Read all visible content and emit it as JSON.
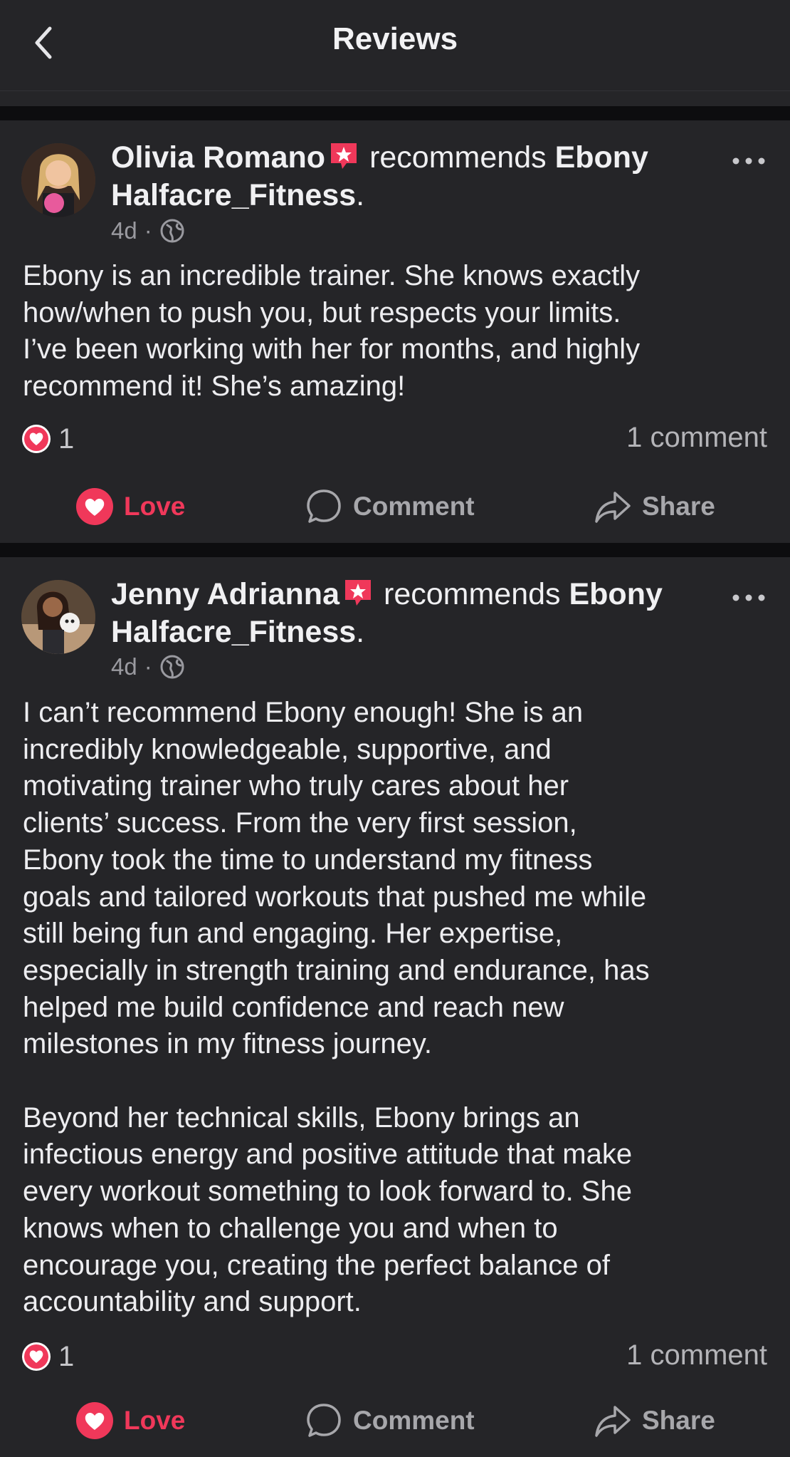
{
  "header": {
    "title": "Reviews"
  },
  "reviews": [
    {
      "author": "Olivia Romano",
      "verb": "recommends",
      "page_line1": "Ebony",
      "page_line2": "Halfacre_Fitness",
      "period": ".",
      "time": "4d",
      "separator": "·",
      "text": "Ebony is an incredible trainer. She knows exactly\nhow/when to push you, but respects your limits.\nI’ve been working with her for months, and highly\nrecommend it! She’s amazing!",
      "reaction_count": "1",
      "comment_count": "1 comment"
    },
    {
      "author": "Jenny Adrianna",
      "verb": "recommends",
      "page_line1": "Ebony",
      "page_line2": "Halfacre_Fitness",
      "period": ".",
      "time": "4d",
      "separator": "·",
      "text": "I can’t recommend Ebony enough! She is an\nincredibly knowledgeable, supportive, and\nmotivating trainer who truly cares about her\nclients’ success. From the very first session,\nEbony took the time to understand my fitness\ngoals and tailored workouts that pushed me while\nstill being fun and engaging. Her expertise,\nespecially in strength training and endurance, has\nhelped me build confidence and reach new\nmilestones in my fitness journey.\n\nBeyond her technical skills, Ebony brings an\ninfectious energy and positive attitude that make\nevery workout something to look forward to. She\nknows when to challenge you and when to\nencourage you, creating the perfect balance of\naccountability and support.",
      "reaction_count": "1",
      "comment_count": "1 comment"
    }
  ],
  "actions": {
    "love": "Love",
    "comment": "Comment",
    "share": "Share"
  },
  "colors": {
    "accent": "#f0385a",
    "background": "#252528",
    "separator": "#0d0d0f"
  }
}
